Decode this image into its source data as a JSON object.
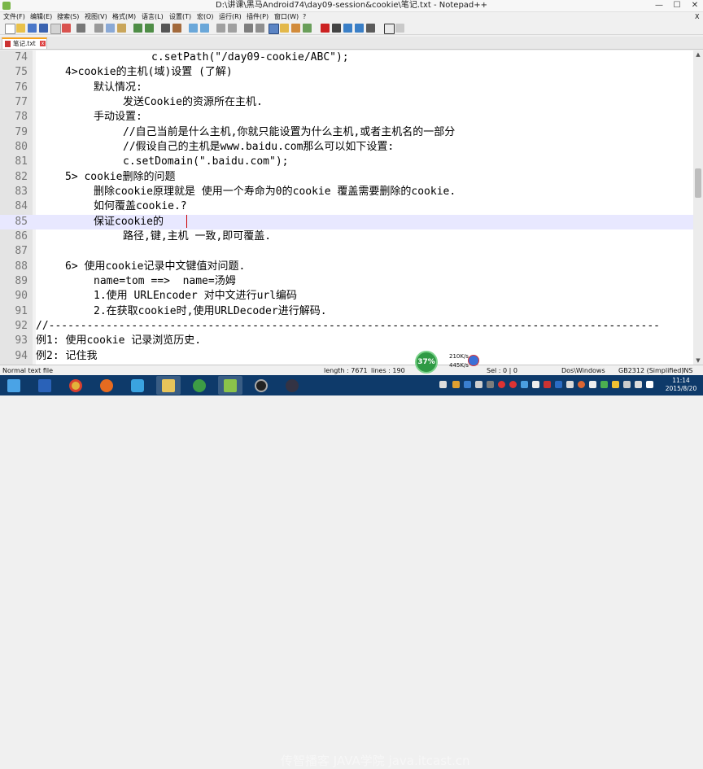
{
  "window": {
    "title": "D:\\讲课\\黑马Android74\\day09-session&cookie\\笔记.txt - Notepad++",
    "minimize": "—",
    "maximize": "☐",
    "close": "✕"
  },
  "menu": [
    {
      "label": "文件(F)"
    },
    {
      "label": "编辑(E)"
    },
    {
      "label": "搜索(S)"
    },
    {
      "label": "视图(V)"
    },
    {
      "label": "格式(M)"
    },
    {
      "label": "语言(L)"
    },
    {
      "label": "设置(T)"
    },
    {
      "label": "宏(O)"
    },
    {
      "label": "运行(R)"
    },
    {
      "label": "插件(P)"
    },
    {
      "label": "窗口(W)"
    },
    {
      "label": "?"
    }
  ],
  "menu_close": "X",
  "tab": {
    "label": "笔记.txt",
    "close": "x"
  },
  "editor": {
    "lines": [
      {
        "num": "74",
        "indent": 1,
        "text": "c.setPath(\"/day09-cookie/ABC\");"
      },
      {
        "num": "75",
        "indent": 2,
        "text": "4>cookie的主机(域)设置 (了解)"
      },
      {
        "num": "76",
        "indent": 3,
        "text": "默认情况:"
      },
      {
        "num": "77",
        "indent": 4,
        "text": "发送Cookie的资源所在主机."
      },
      {
        "num": "78",
        "indent": 3,
        "text": "手动设置:"
      },
      {
        "num": "79",
        "indent": 4,
        "text": "//自己当前是什么主机,你就只能设置为什么主机,或者主机名的一部分"
      },
      {
        "num": "80",
        "indent": 4,
        "text": "//假设自己的主机是www.baidu.com那么可以如下设置:"
      },
      {
        "num": "81",
        "indent": 4,
        "text": "c.setDomain(\".baidu.com\");"
      },
      {
        "num": "82",
        "indent": 2,
        "text": "5> cookie删除的问题"
      },
      {
        "num": "83",
        "indent": 3,
        "text": "删除cookie原理就是 使用一个寿命为0的cookie 覆盖需要删除的cookie."
      },
      {
        "num": "84",
        "indent": 3,
        "text": "如何覆盖cookie.?"
      },
      {
        "num": "85",
        "indent": 3,
        "text": "保证cookie的 "
      },
      {
        "num": "86",
        "indent": 4,
        "text": "路径,键,主机 一致,即可覆盖."
      },
      {
        "num": "87",
        "indent": 0,
        "text": ""
      },
      {
        "num": "88",
        "indent": 2,
        "text": "6> 使用cookie记录中文键值对问题."
      },
      {
        "num": "89",
        "indent": 3,
        "text": "name=tom ==>  name=汤姆"
      },
      {
        "num": "90",
        "indent": 3,
        "text": "1.使用 URLEncoder 对中文进行url编码"
      },
      {
        "num": "91",
        "indent": 3,
        "text": "2.在获取cookie时,使用URLDecoder进行解码."
      },
      {
        "num": "92",
        "indent": 0,
        "text": "//------------------------------------------------------------------------------------------------"
      },
      {
        "num": "93",
        "indent": 0,
        "text": "例1: 使用cookie 记录浏览历史."
      },
      {
        "num": "94",
        "indent": 0,
        "text": "例2: 记住我"
      }
    ],
    "current_line": "85"
  },
  "status": {
    "file_type": "Normal text file",
    "length": "length : 7671",
    "lines": "lines : 190",
    "sel": "Sel : 0 | 0",
    "eol": "Dos\\Windows",
    "encoding": "GB2312 (Simplified)",
    "mode": "INS"
  },
  "network": {
    "percent": "37%",
    "up": "210K/s",
    "down": "445K/s"
  },
  "taskbar": {
    "watermark": "传智播客 JAVA学院 java.itcast.cn",
    "time": "11:14",
    "date": "2015/8/20"
  }
}
